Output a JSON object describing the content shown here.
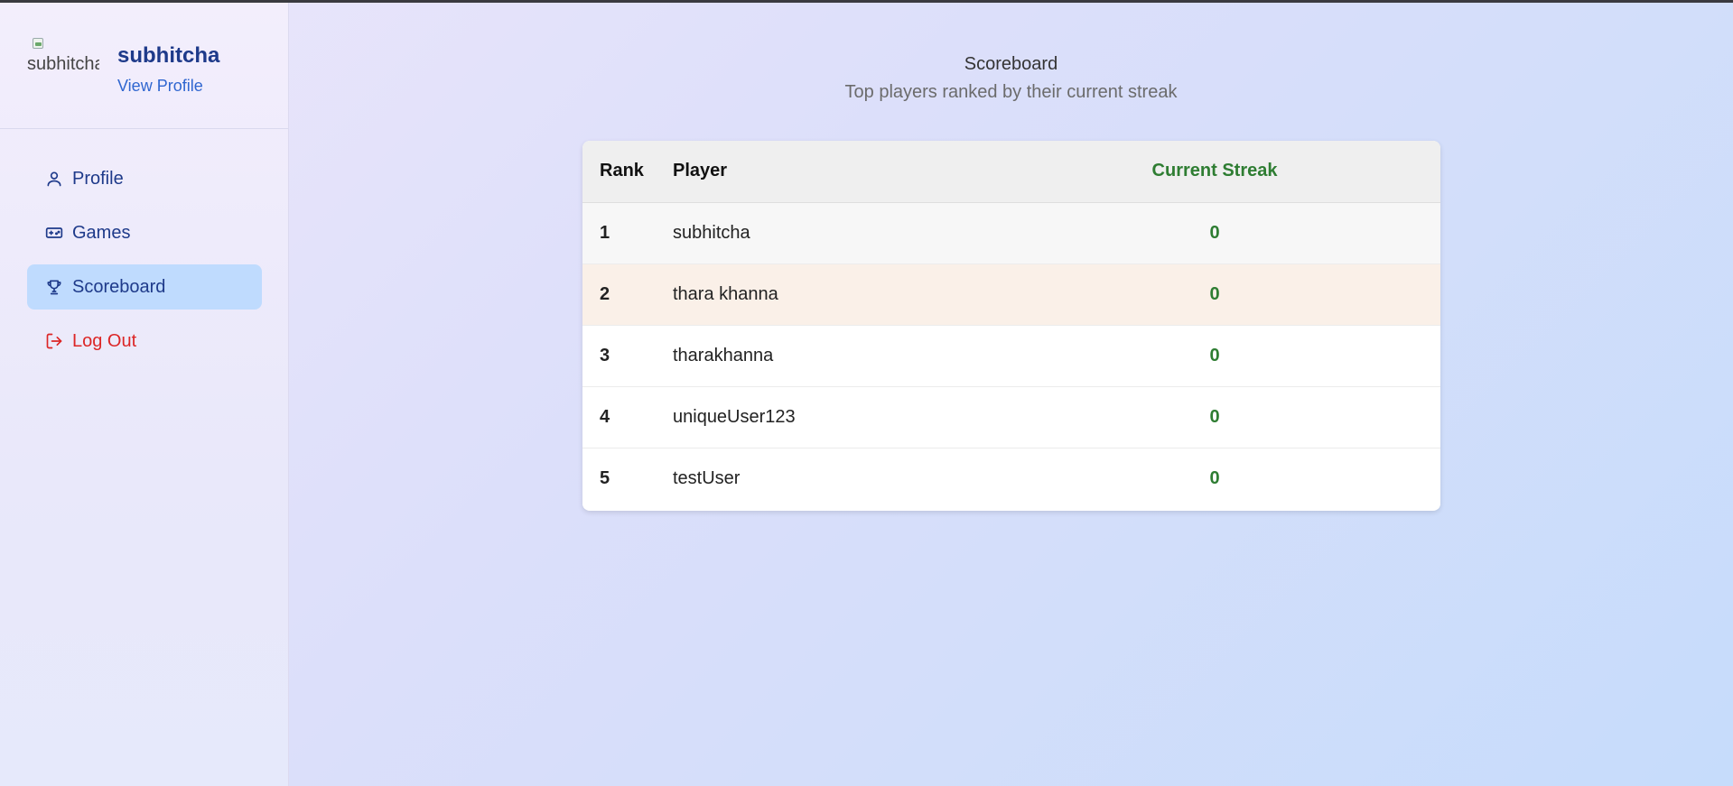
{
  "sidebar": {
    "avatar_alt": "subhitcha",
    "username": "subhitcha",
    "view_profile": "View Profile",
    "items": [
      {
        "label": "Profile",
        "icon": "user-icon",
        "active": false
      },
      {
        "label": "Games",
        "icon": "gamepad-icon",
        "active": false
      },
      {
        "label": "Scoreboard",
        "icon": "trophy-icon",
        "active": true
      },
      {
        "label": "Log Out",
        "icon": "logout-icon",
        "active": false
      }
    ]
  },
  "main": {
    "title": "Scoreboard",
    "subtitle": "Top players ranked by their current streak",
    "table": {
      "headers": [
        "Rank",
        "Player",
        "Current Streak"
      ],
      "rows": [
        {
          "rank": "1",
          "player": "subhitcha",
          "streak": "0"
        },
        {
          "rank": "2",
          "player": "thara khanna",
          "streak": "0"
        },
        {
          "rank": "3",
          "player": "tharakhanna",
          "streak": "0"
        },
        {
          "rank": "4",
          "player": "uniqueUser123",
          "streak": "0"
        },
        {
          "rank": "5",
          "player": "testUser",
          "streak": "0"
        }
      ]
    }
  },
  "colors": {
    "nav_text": "#1e3a8a",
    "active_bg": "#bfdbfe",
    "logout": "#dc2626",
    "streak": "#2e7d32",
    "link": "#2f66d0"
  }
}
